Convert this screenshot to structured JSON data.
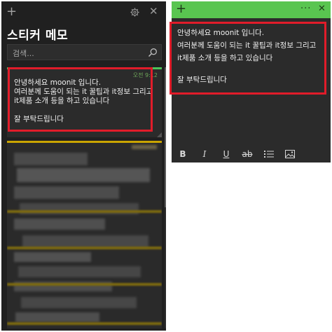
{
  "list": {
    "title": "스티커 메모",
    "search_placeholder": "검색...",
    "note": {
      "time": "오전 9:12",
      "lines": [
        "안녕하세요 moonit 입니다.",
        "여러분께 도움이 되는 it 꿀팁과 it정보 그리고",
        "it제품 소개 등을 하고 있습니다",
        "",
        "잘 부탁드립니다"
      ]
    }
  },
  "editor": {
    "lines": [
      "안녕하세요 moonit 입니다.",
      "여러분께 도움이 되는 it 꿀팁과 it정보 그리고",
      "it제품 소개 등을 하고 있습니다",
      "",
      "잘 부탁드립니다"
    ],
    "format": {
      "bold": "B",
      "italic": "I",
      "underline": "U",
      "strike": "ab"
    }
  },
  "icons": {
    "add": "plus-icon",
    "settings": "gear-icon",
    "close": "close-icon",
    "more": "more-icon",
    "search": "search-icon",
    "list": "bullet-list-icon",
    "image": "image-icon"
  },
  "colors": {
    "note_accent": "#4bc35a",
    "editor_bar": "#59c550",
    "highlight": "#e11c2a",
    "blurred_note_accent": "#c9a400"
  }
}
